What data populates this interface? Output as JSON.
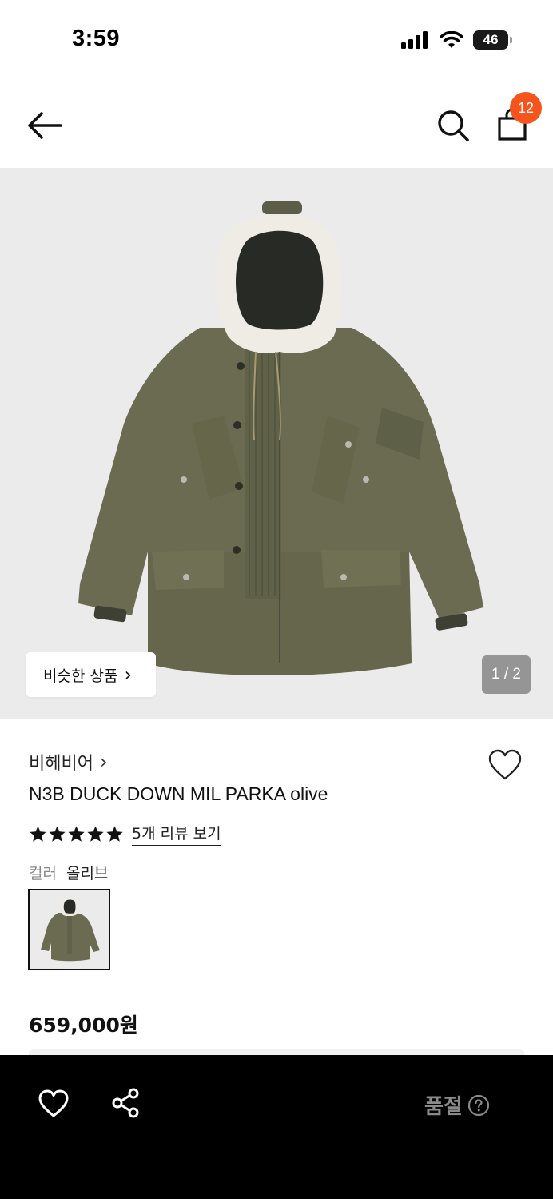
{
  "status_bar": {
    "time": "3:59",
    "battery": "46",
    "icons": [
      "signal-icon",
      "wifi-icon",
      "battery-icon"
    ]
  },
  "header": {
    "back_icon": "arrow-left-icon",
    "search_icon": "search-icon",
    "bag_icon": "shopping-bag-icon",
    "cart_count": "12",
    "badge_color": "#f5541c"
  },
  "gallery": {
    "similar_products_label": "비슷한 상품",
    "similar_chevron": "›",
    "page_indicator": "1 / 2",
    "background": "#ebebeb"
  },
  "product": {
    "brand": "비헤비어",
    "brand_chevron": "›",
    "name": "N3B DUCK DOWN MIL PARKA olive",
    "rating_stars": 5,
    "review_link": "5개 리뷰 보기",
    "color_label": "컬러",
    "color_value": "올리브",
    "price": "659,000원"
  },
  "bottom_bar": {
    "heart_icon": "heart-icon",
    "share_icon": "share-icon",
    "status": "품절",
    "help_icon": "question-circle-icon"
  }
}
